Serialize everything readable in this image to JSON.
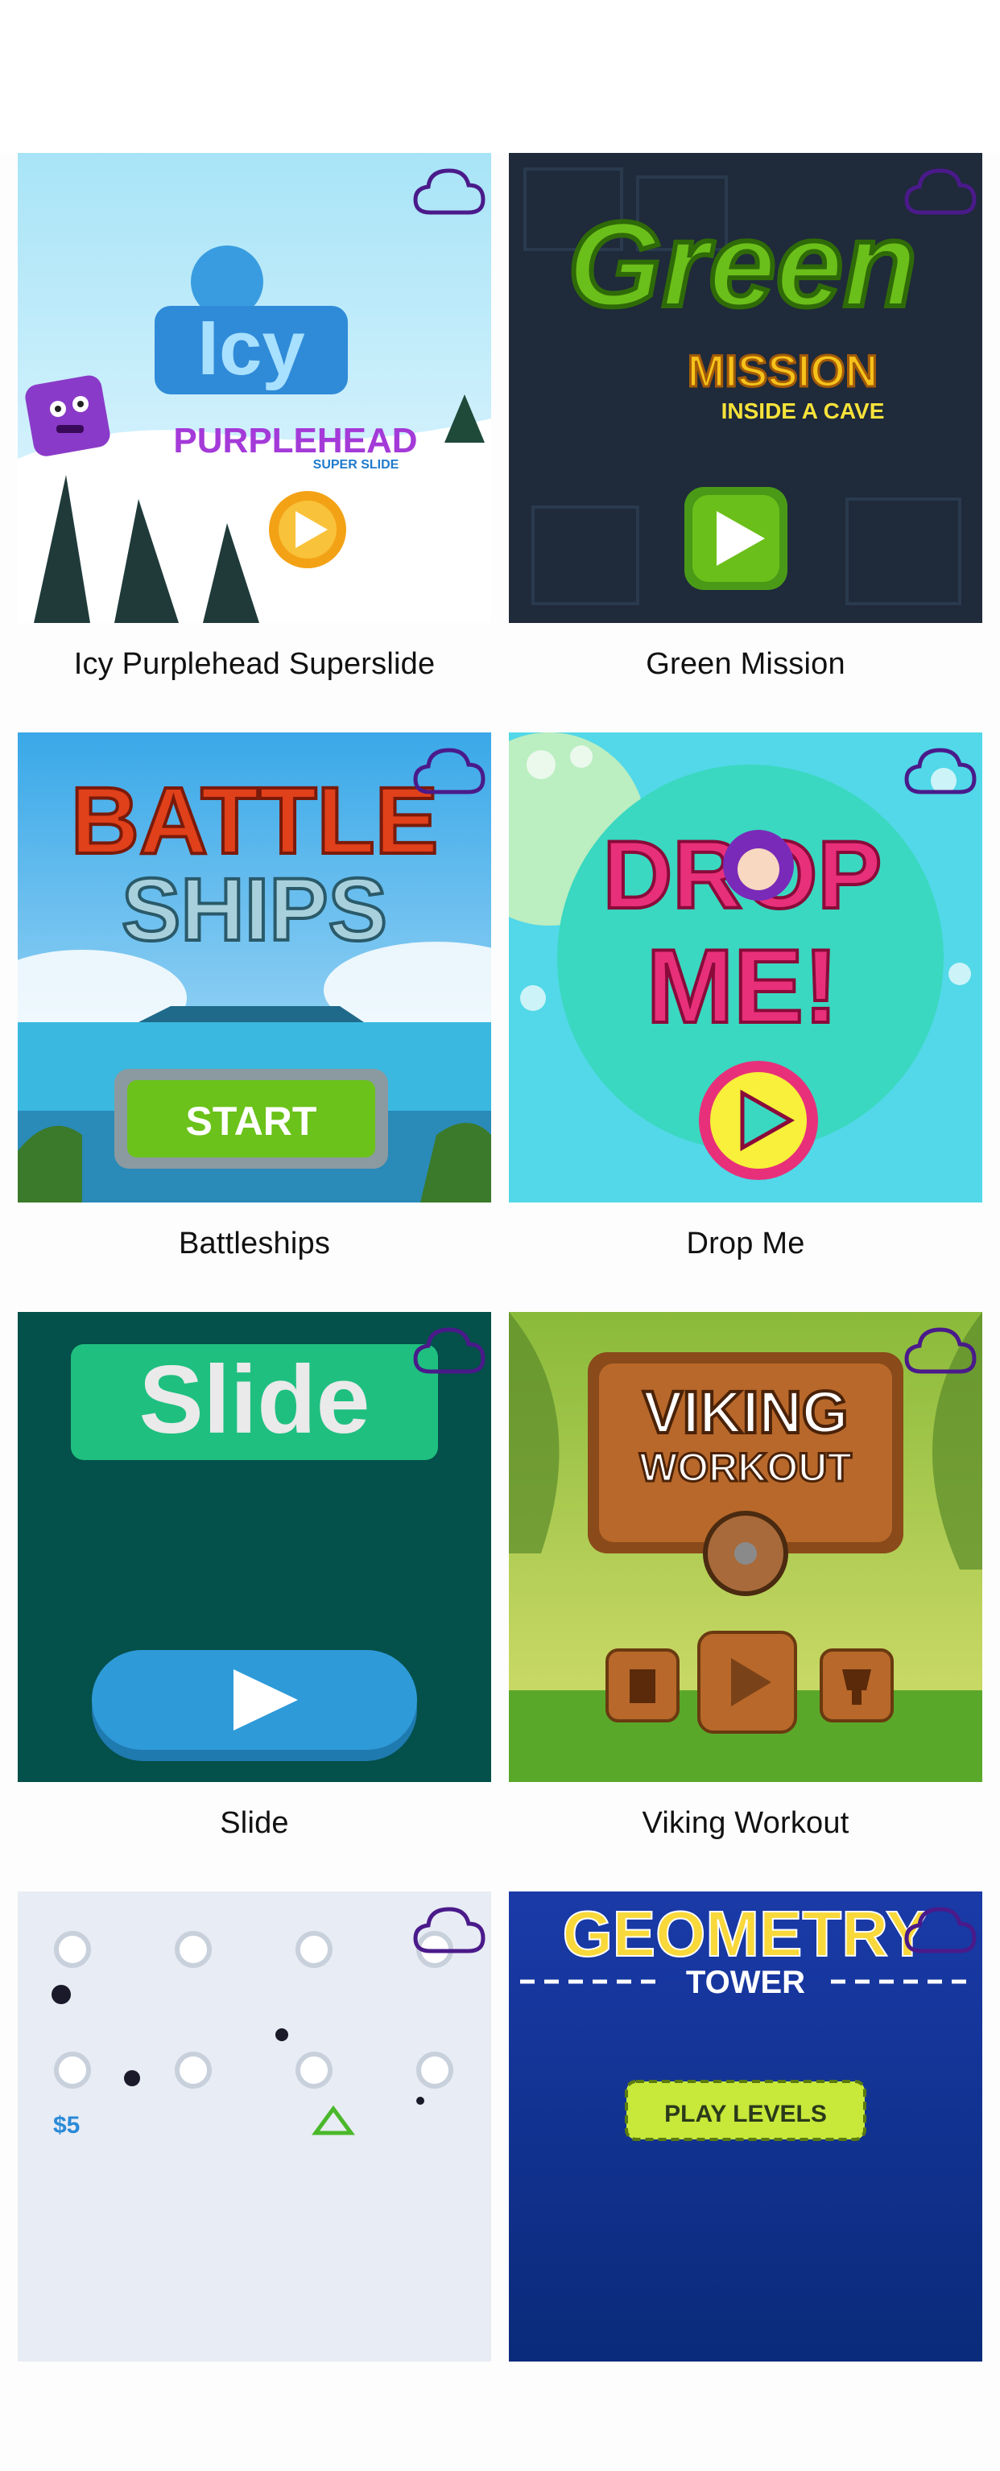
{
  "games": [
    {
      "title": "Icy Purplehead Superslide",
      "art_title": "Icy",
      "art_subtitle": "PURPLEHEAD",
      "art_badge": "SUPER SLIDE",
      "cloud_icon": "cloud-download-icon"
    },
    {
      "title": "Green Mission",
      "art_title": "Green",
      "art_subtitle": "MISSION",
      "art_tagline": "INSIDE A CAVE",
      "cloud_icon": "cloud-download-icon"
    },
    {
      "title": "Battleships",
      "art_title": "BATTLE",
      "art_subtitle": "SHIPS",
      "art_button": "START",
      "cloud_icon": "cloud-download-icon"
    },
    {
      "title": "Drop Me",
      "art_title": "DROP",
      "art_subtitle": "ME!",
      "cloud_icon": "cloud-download-icon"
    },
    {
      "title": "Slide",
      "art_title": "Slide",
      "cloud_icon": "cloud-download-icon"
    },
    {
      "title": "Viking Workout",
      "art_title": "VIKING",
      "art_subtitle": "WORKOUT",
      "cloud_icon": "cloud-download-icon"
    },
    {
      "title": "",
      "art_price": "$5",
      "cloud_icon": "cloud-download-icon"
    },
    {
      "title": "",
      "art_title": "GEOMETRY",
      "art_subtitle": "TOWER",
      "art_button": "PLAY LEVELS",
      "cloud_icon": "cloud-download-icon"
    }
  ],
  "colors": {
    "cloud_icon": "#4a1a8a",
    "caption_text": "#111111",
    "background": "#fdfdfd"
  }
}
